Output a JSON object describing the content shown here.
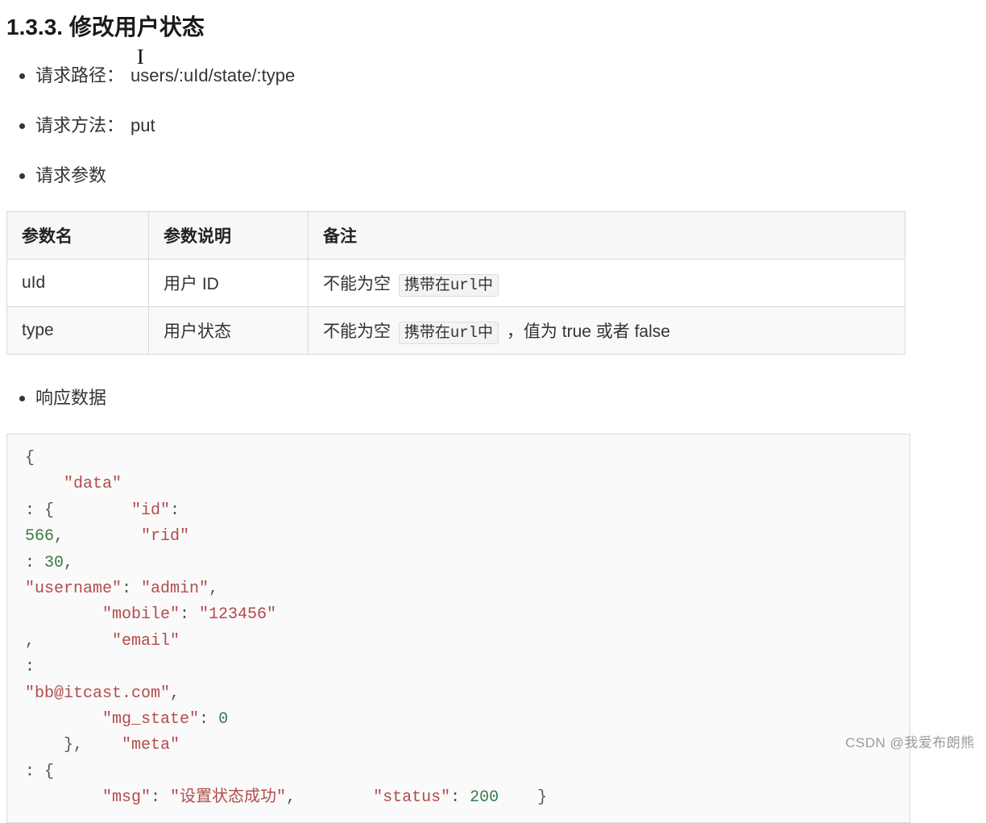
{
  "heading": "1.3.3. 修改用户状态",
  "bullets": {
    "path": {
      "label": "请求路径：",
      "value": "users/:uId/state/:type"
    },
    "method": {
      "label": "请求方法：",
      "value": "put"
    },
    "params": {
      "label": "请求参数"
    },
    "resp": {
      "label": "响应数据"
    }
  },
  "table": {
    "headers": [
      "参数名",
      "参数说明",
      "备注"
    ],
    "rows": [
      {
        "name": "uId",
        "desc": "用户 ID",
        "remark_prefix": "不能为空",
        "remark_code": "携带在url中",
        "remark_suffix": ""
      },
      {
        "name": "type",
        "desc": "用户状态",
        "remark_prefix": "不能为空",
        "remark_code": "携带在url中",
        "remark_suffix": "，值为 true 或者 false"
      }
    ]
  },
  "code": {
    "tokens": [
      [
        "p",
        "{"
      ],
      [
        "p",
        "    "
      ],
      [
        "k",
        "\"data\""
      ],
      [
        "p",
        ": {"
      ],
      [
        "p",
        "        "
      ],
      [
        "k",
        "\"id\""
      ],
      [
        "p",
        ": "
      ],
      [
        "n",
        "566"
      ],
      [
        "p",
        ","
      ],
      [
        "p",
        "        "
      ],
      [
        "k",
        "\"rid\""
      ],
      [
        "p",
        ": "
      ],
      [
        "n",
        "30"
      ],
      [
        "p",
        ","
      ],
      [
        "p",
        "        "
      ],
      [
        "k",
        "\"username\""
      ],
      [
        "p",
        ": "
      ],
      [
        "s",
        "\"admin\""
      ],
      [
        "p",
        ","
      ],
      [
        "p",
        "        "
      ],
      [
        "k",
        "\"mobile\""
      ],
      [
        "p",
        ": "
      ],
      [
        "s",
        "\"123456\""
      ],
      [
        "p",
        ","
      ],
      [
        "p",
        "        "
      ],
      [
        "k",
        "\"email\""
      ],
      [
        "p",
        ": "
      ],
      [
        "s",
        "\"bb@itcast.com\""
      ],
      [
        "p",
        ","
      ],
      [
        "p",
        "        "
      ],
      [
        "k",
        "\"mg_state\""
      ],
      [
        "p",
        ": "
      ],
      [
        "n",
        "0"
      ],
      [
        "p",
        "    },"
      ],
      [
        "p",
        "    "
      ],
      [
        "k",
        "\"meta\""
      ],
      [
        "p",
        ": {"
      ],
      [
        "p",
        "        "
      ],
      [
        "k",
        "\"msg\""
      ],
      [
        "p",
        ": "
      ],
      [
        "s",
        "\"设置状态成功\""
      ],
      [
        "p",
        ","
      ],
      [
        "p",
        "        "
      ],
      [
        "k",
        "\"status\""
      ],
      [
        "p",
        ": "
      ],
      [
        "n",
        "200"
      ],
      [
        "p",
        "    }"
      ]
    ],
    "linebreaks": [
      1,
      3,
      7,
      11,
      15,
      19,
      23,
      26,
      27,
      29,
      33,
      36,
      37
    ]
  },
  "watermark": "CSDN @我爱布朗熊",
  "caret": "I"
}
